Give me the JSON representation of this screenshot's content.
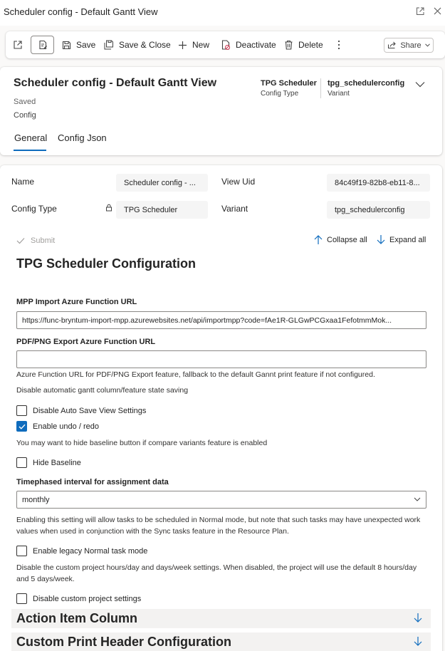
{
  "window": {
    "title": "Scheduler config - Default Gantt View"
  },
  "commandbar": {
    "save": "Save",
    "save_close": "Save & Close",
    "new": "New",
    "deactivate": "Deactivate",
    "delete": "Delete",
    "share": "Share"
  },
  "header": {
    "title": "Scheduler config - Default Gantt View",
    "dash": "-",
    "status": "Saved",
    "entity": "Config",
    "fields": [
      {
        "value": "TPG Scheduler",
        "label": "Config Type"
      },
      {
        "value": "tpg_schedulerconfig",
        "label": "Variant"
      }
    ],
    "tabs": [
      {
        "label": "General",
        "selected": true
      },
      {
        "label": "Config Json",
        "selected": false
      }
    ]
  },
  "form": {
    "name_label": "Name",
    "name_value": "Scheduler config - ...",
    "view_uid_label": "View Uid",
    "view_uid_value": "84c49f19-82b8-eb11-8...",
    "config_type_label": "Config Type",
    "config_type_value": "TPG Scheduler",
    "variant_label": "Variant",
    "variant_value": "tpg_schedulerconfig"
  },
  "config": {
    "submit": "Submit",
    "collapse_all": "Collapse all",
    "expand_all": "Expand all",
    "title": "TPG Scheduler Configuration",
    "mpp_label": "MPP Import Azure Function URL",
    "mpp_value": "https://func-bryntum-import-mpp.azurewebsites.net/api/importmpp?code=fAe1R-GLGwPCGxaa1FefotmmMok...",
    "pdf_label": "PDF/PNG Export Azure Function URL",
    "pdf_value": "",
    "pdf_help": "Azure Function URL for PDF/PNG Export feature, fallback to the default Gannt print feature if not configured.",
    "autosave_help": "Disable automatic gantt column/feature state saving",
    "autosave_label": "Disable Auto Save View Settings",
    "autosave_checked": false,
    "undo_label": "Enable undo / redo",
    "undo_checked": true,
    "baseline_help": "You may want to hide baseline button if compare variants feature is enabled",
    "baseline_label": "Hide Baseline",
    "baseline_checked": false,
    "timephased_label": "Timephased interval for assignment data",
    "timephased_value": "monthly",
    "legacy_help": "Enabling this setting will allow tasks to be scheduled in Normal mode, but note that such tasks may have unexpected work values when used in conjunction with the Sync tasks feature in the Resource Plan.",
    "legacy_label": "Enable legacy Normal task mode",
    "legacy_checked": false,
    "custom_help": "Disable the custom project hours/day and days/week settings. When disabled, the project will use the default 8 hours/day and 5 days/week.",
    "custom_label": "Disable custom project settings",
    "custom_checked": false,
    "sections": [
      "Action Item Column",
      "Custom Print Header Configuration"
    ]
  },
  "colors": {
    "accent": "#0f6cbd",
    "section_bg": "#f3f2f1"
  }
}
